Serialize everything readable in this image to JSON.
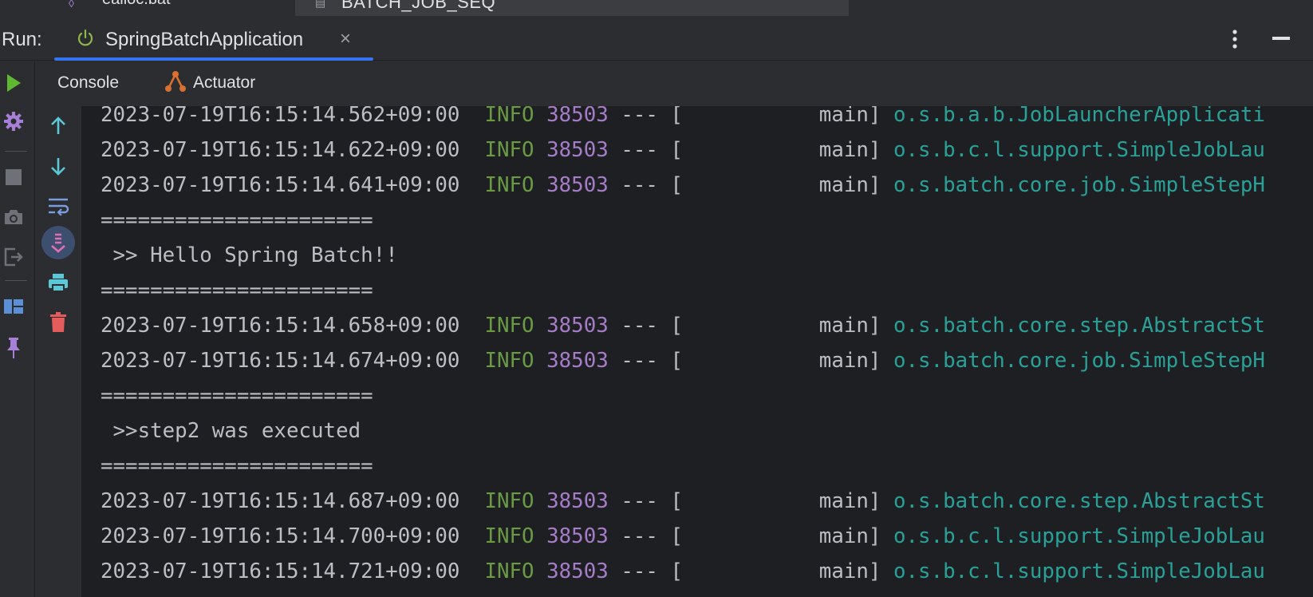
{
  "top_strip": {
    "left_fragment": "ealloc.bat",
    "editor_tab": "BATCH_JOB_SEQ"
  },
  "run_panel": {
    "run_label": "Run:",
    "config_tab": {
      "title": "SpringBatchApplication",
      "close": "×"
    },
    "icons": [
      "power-icon",
      "more-icon",
      "minimize-icon"
    ]
  },
  "left_toolbar": {
    "icons": [
      "run-icon",
      "settings-icon",
      "stop-icon",
      "camera-icon",
      "exit-icon",
      "layout-icon",
      "pin-icon"
    ]
  },
  "subtabs": {
    "console": "Console",
    "actuator": "Actuator"
  },
  "console_toolbar": {
    "icons": [
      "arrow-up-icon",
      "arrow-down-icon",
      "soft-wrap-icon",
      "scroll-to-end-icon",
      "print-icon",
      "trash-icon"
    ]
  },
  "colors": {
    "accent": "#3574f0",
    "info": "#6a9a44",
    "pid": "#a57cc8",
    "logger": "#2aa198",
    "run_green": "#5fb832",
    "delete_red": "#e55c5c"
  },
  "console": {
    "lines": [
      {
        "type": "log",
        "ts": "2023-07-19T16:15:14.562+09:00",
        "level": "INFO",
        "pid": "38503",
        "sep": "---",
        "thread": "[           main]",
        "logger": "o.s.b.a.b.JobLauncherApplicati"
      },
      {
        "type": "log",
        "ts": "2023-07-19T16:15:14.622+09:00",
        "level": "INFO",
        "pid": "38503",
        "sep": "---",
        "thread": "[           main]",
        "logger": "o.s.b.c.l.support.SimpleJobLau"
      },
      {
        "type": "log",
        "ts": "2023-07-19T16:15:14.641+09:00",
        "level": "INFO",
        "pid": "38503",
        "sep": "---",
        "thread": "[           main]",
        "logger": "o.s.batch.core.job.SimpleStepH"
      },
      {
        "type": "text",
        "text": "======================"
      },
      {
        "type": "text",
        "text": " >> Hello Spring Batch!!"
      },
      {
        "type": "text",
        "text": "======================"
      },
      {
        "type": "log",
        "ts": "2023-07-19T16:15:14.658+09:00",
        "level": "INFO",
        "pid": "38503",
        "sep": "---",
        "thread": "[           main]",
        "logger": "o.s.batch.core.step.AbstractSt"
      },
      {
        "type": "log",
        "ts": "2023-07-19T16:15:14.674+09:00",
        "level": "INFO",
        "pid": "38503",
        "sep": "---",
        "thread": "[           main]",
        "logger": "o.s.batch.core.job.SimpleStepH"
      },
      {
        "type": "text",
        "text": "======================"
      },
      {
        "type": "text",
        "text": " >>step2 was executed"
      },
      {
        "type": "text",
        "text": "======================"
      },
      {
        "type": "log",
        "ts": "2023-07-19T16:15:14.687+09:00",
        "level": "INFO",
        "pid": "38503",
        "sep": "---",
        "thread": "[           main]",
        "logger": "o.s.batch.core.step.AbstractSt"
      },
      {
        "type": "log",
        "ts": "2023-07-19T16:15:14.700+09:00",
        "level": "INFO",
        "pid": "38503",
        "sep": "---",
        "thread": "[           main]",
        "logger": "o.s.b.c.l.support.SimpleJobLau"
      },
      {
        "type": "log",
        "ts": "2023-07-19T16:15:14.721+09:00",
        "level": "INFO",
        "pid": "38503",
        "sep": "---",
        "thread": "[           main]",
        "logger": "o.s.b.c.l.support.SimpleJobLau"
      }
    ]
  }
}
